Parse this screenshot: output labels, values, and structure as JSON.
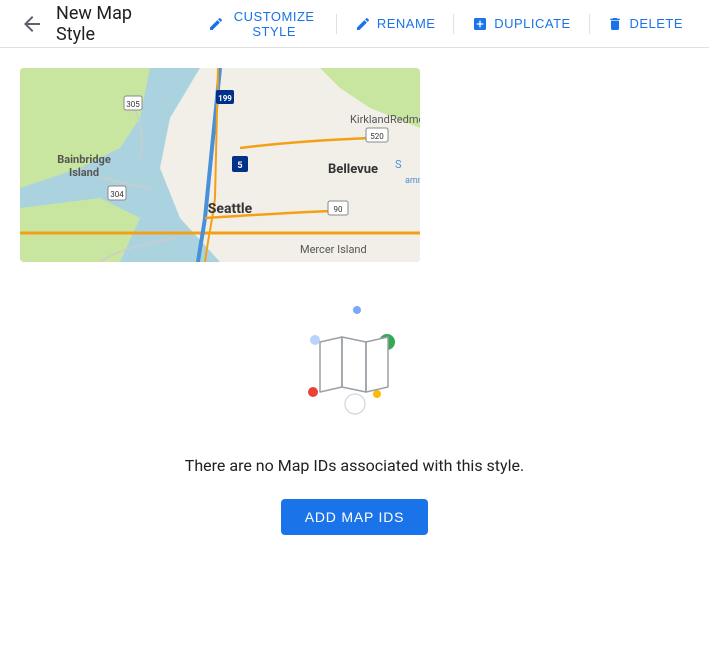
{
  "header": {
    "back_icon": "arrow-left",
    "title": "New Map Style",
    "actions": [
      {
        "id": "customize",
        "label": "CUSTOMIZE STYLE",
        "icon": "pencil"
      },
      {
        "id": "rename",
        "label": "RENAME",
        "icon": "pencil-small"
      },
      {
        "id": "duplicate",
        "label": "DUPLICATE",
        "icon": "plus-box"
      },
      {
        "id": "delete",
        "label": "DELETE",
        "icon": "trash"
      }
    ]
  },
  "empty_state": {
    "message": "There are no Map IDs associated with this style.",
    "button_label": "ADD MAP IDS"
  },
  "colors": {
    "primary": "#1a73e8",
    "dot_blue": "#4285f4",
    "dot_green": "#34a853",
    "dot_red": "#ea4335",
    "dot_yellow": "#fbbc04",
    "dot_light_blue": "#8ab4f8",
    "dot_gray_light": "#dadce0"
  }
}
